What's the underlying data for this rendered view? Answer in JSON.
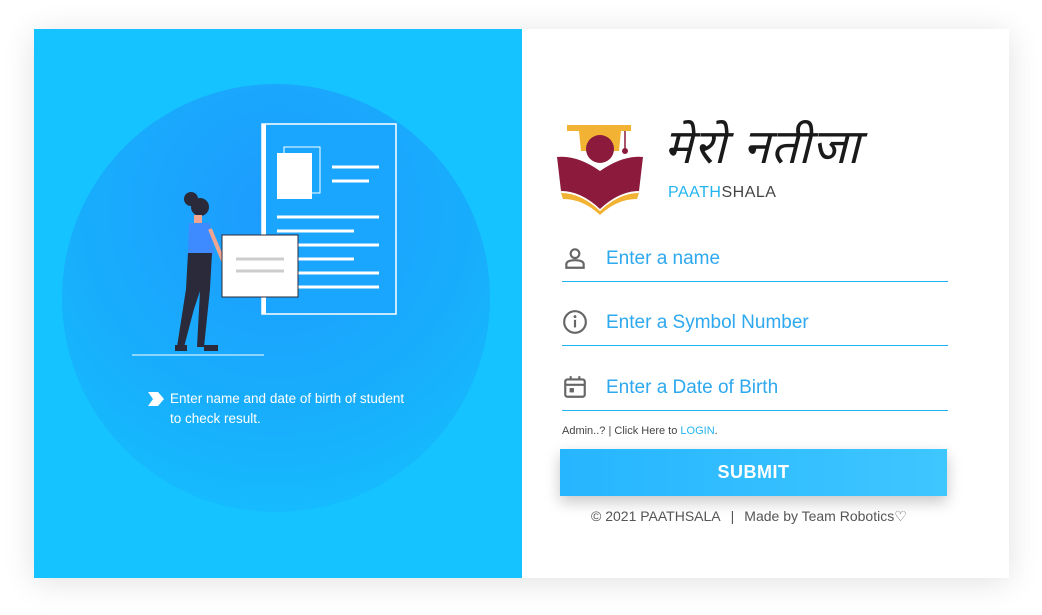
{
  "left_panel": {
    "hint_text_1": "Enter name and date of birth of student",
    "hint_text_2": "to check result."
  },
  "brand": {
    "title": "मेरो नतीजा",
    "sub_accent": "PAATH",
    "sub_rest": "SHALA"
  },
  "form": {
    "name_placeholder": "Enter a name",
    "symbol_placeholder": "Enter a Symbol Number",
    "dob_placeholder": "Enter a Date of Birth",
    "admin_text": "Admin..? | Click Here to ",
    "login_link": "LOGIN",
    "admin_suffix": ".",
    "submit_label": "SUBMIT"
  },
  "footer": {
    "copyright": "© 2021 PAATHSALA",
    "separator": "|",
    "credit": "Made by Team Robotics♡"
  },
  "colors": {
    "panel_blue": "#14c3ff",
    "accent": "#23b4ef",
    "logo_maroon": "#8b1a3c",
    "logo_gold": "#f2b233"
  },
  "icons": [
    "person-icon",
    "info-icon",
    "calendar-icon",
    "chevron-icon"
  ]
}
